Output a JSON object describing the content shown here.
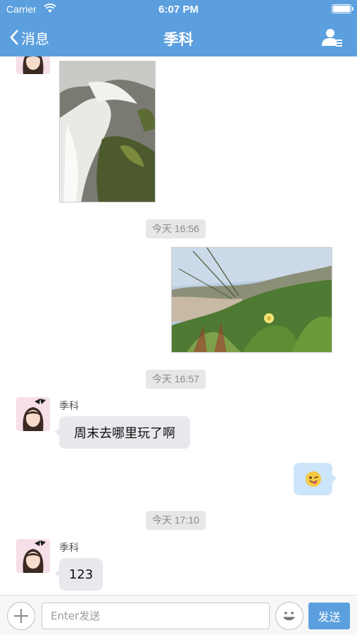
{
  "status_bar": {
    "carrier": "Carrier",
    "time": "6:07 PM"
  },
  "nav": {
    "back_label": "消息",
    "title": "季科"
  },
  "messages": [
    {
      "type": "image",
      "side": "left",
      "subject": "waterfall"
    },
    {
      "type": "timestamp",
      "text": "今天 16:56"
    },
    {
      "type": "image",
      "side": "right",
      "subject": "dune plants with yellow flower"
    },
    {
      "type": "timestamp",
      "text": "今天 16:57"
    },
    {
      "type": "text",
      "side": "left",
      "sender": "季科",
      "text": "周末去哪里玩了啊"
    },
    {
      "type": "emoji",
      "side": "right",
      "icon": "winking-tongue-emoji-icon"
    },
    {
      "type": "timestamp",
      "text": "今天 17:10"
    },
    {
      "type": "text",
      "side": "left",
      "sender": "季科",
      "text": "123"
    }
  ],
  "input_bar": {
    "placeholder": "Enter发送",
    "value": "",
    "send_label": "发送"
  },
  "colors": {
    "accent": "#5b9fde",
    "bubble_left": "#e7e9ec",
    "bubble_right": "#cde5fb",
    "timestamp_bg": "#e7e7e7"
  }
}
